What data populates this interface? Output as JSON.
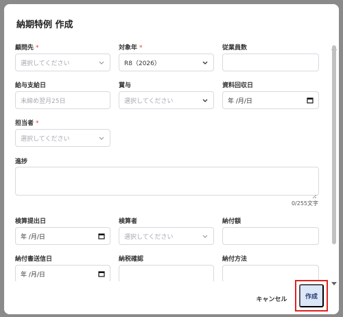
{
  "dialog": {
    "title": "納期特例 作成",
    "required_mark": "*"
  },
  "fields": {
    "client": {
      "label": "顧問先",
      "placeholder": "選択してください"
    },
    "target_year": {
      "label": "対象年",
      "value": "R8（2026）"
    },
    "employee_count": {
      "label": "従業員数",
      "value": ""
    },
    "payday": {
      "label": "給与支給日",
      "placeholder": "末締め翌月25日"
    },
    "bonus": {
      "label": "賞与",
      "placeholder": "選択してください"
    },
    "collection_date": {
      "label": "資料回収日",
      "value": "年 /月/日"
    },
    "assignee": {
      "label": "担当者",
      "placeholder": "選択してください"
    },
    "progress": {
      "label": "進捗",
      "counter": "0/255文字"
    },
    "check_submit_date": {
      "label": "検算提出日",
      "value": "年 /月/日"
    },
    "checker": {
      "label": "検算者",
      "placeholder": "選択してください"
    },
    "payment_amount": {
      "label": "納付額",
      "value": ""
    },
    "payment_doc_send_date": {
      "label": "納付書送信日",
      "value": "年 /月/日"
    },
    "tax_confirm": {
      "label": "納税確認",
      "value": ""
    },
    "payment_method": {
      "label": "納付方法",
      "value": ""
    }
  },
  "footer": {
    "cancel_label": "キャンセル",
    "create_label": "作成"
  },
  "colors": {
    "required": "#e53935",
    "highlight_border": "#e02020",
    "primary_bg": "#dce6f9",
    "primary_text": "#2a3f74"
  }
}
